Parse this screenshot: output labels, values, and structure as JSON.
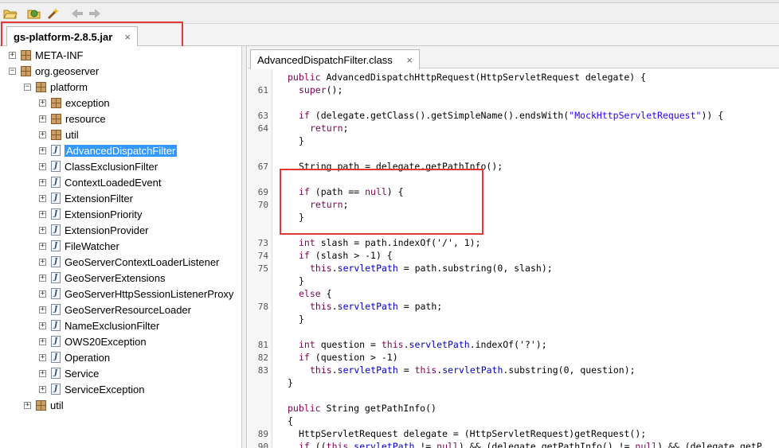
{
  "toolbar": {
    "icons": [
      "open-folder-icon",
      "open-type-icon",
      "wand-icon",
      "back-arrow-icon",
      "forward-arrow-icon"
    ]
  },
  "jar_tab": {
    "title": "gs-platform-2.8.5.jar",
    "close": "×"
  },
  "editor_tab": {
    "title": "AdvancedDispatchFilter.class",
    "close": "×"
  },
  "tree": {
    "items": [
      {
        "label": "META-INF",
        "type": "package",
        "indent": 0,
        "expander": "+"
      },
      {
        "label": "org.geoserver",
        "type": "package",
        "indent": 0,
        "expander": "−"
      },
      {
        "label": "platform",
        "type": "package",
        "indent": 1,
        "expander": "−"
      },
      {
        "label": "exception",
        "type": "package",
        "indent": 2,
        "expander": "+"
      },
      {
        "label": "resource",
        "type": "package",
        "indent": 2,
        "expander": "+"
      },
      {
        "label": "util",
        "type": "package",
        "indent": 2,
        "expander": "+"
      },
      {
        "label": "AdvancedDispatchFilter",
        "type": "class",
        "indent": 2,
        "expander": "+",
        "selected": true
      },
      {
        "label": "ClassExclusionFilter",
        "type": "class",
        "indent": 2,
        "expander": "+"
      },
      {
        "label": "ContextLoadedEvent",
        "type": "class",
        "indent": 2,
        "expander": "+"
      },
      {
        "label": "ExtensionFilter",
        "type": "class",
        "indent": 2,
        "expander": "+"
      },
      {
        "label": "ExtensionPriority",
        "type": "class",
        "indent": 2,
        "expander": "+"
      },
      {
        "label": "ExtensionProvider",
        "type": "class",
        "indent": 2,
        "expander": "+"
      },
      {
        "label": "FileWatcher",
        "type": "class",
        "indent": 2,
        "expander": "+"
      },
      {
        "label": "GeoServerContextLoaderListener",
        "type": "class",
        "indent": 2,
        "expander": "+"
      },
      {
        "label": "GeoServerExtensions",
        "type": "class",
        "indent": 2,
        "expander": "+"
      },
      {
        "label": "GeoServerHttpSessionListenerProxy",
        "type": "class",
        "indent": 2,
        "expander": "+"
      },
      {
        "label": "GeoServerResourceLoader",
        "type": "class",
        "indent": 2,
        "expander": "+"
      },
      {
        "label": "NameExclusionFilter",
        "type": "class",
        "indent": 2,
        "expander": "+"
      },
      {
        "label": "OWS20Exception",
        "type": "class",
        "indent": 2,
        "expander": "+"
      },
      {
        "label": "Operation",
        "type": "class",
        "indent": 2,
        "expander": "+"
      },
      {
        "label": "Service",
        "type": "class",
        "indent": 2,
        "expander": "+"
      },
      {
        "label": "ServiceException",
        "type": "class",
        "indent": 2,
        "expander": "+"
      },
      {
        "label": "util",
        "type": "package",
        "indent": 1,
        "expander": "+"
      }
    ]
  },
  "code": {
    "lines": [
      {
        "num": "",
        "indent": 1,
        "tokens": [
          [
            "kw",
            "public "
          ],
          [
            "",
            "AdvancedDispatchHttpRequest(HttpServletRequest delegate) {"
          ]
        ]
      },
      {
        "num": "61",
        "indent": 2,
        "tokens": [
          [
            "kw",
            "super"
          ],
          [
            "",
            "();"
          ]
        ]
      },
      {
        "num": "",
        "indent": 0,
        "tokens": []
      },
      {
        "num": "63",
        "indent": 2,
        "tokens": [
          [
            "kw",
            "if "
          ],
          [
            "",
            "(delegate.getClass().getSimpleName().endsWith("
          ],
          [
            "str",
            "\"MockHttpServletRequest\""
          ],
          [
            "",
            ")) {"
          ]
        ]
      },
      {
        "num": "64",
        "indent": 3,
        "tokens": [
          [
            "kw",
            "return"
          ],
          [
            "",
            ";"
          ]
        ]
      },
      {
        "num": "",
        "indent": 2,
        "tokens": [
          [
            "",
            "}"
          ]
        ]
      },
      {
        "num": "",
        "indent": 0,
        "tokens": []
      },
      {
        "num": "67",
        "indent": 2,
        "tokens": [
          [
            "",
            "String path = delegate.getPathInfo();"
          ]
        ]
      },
      {
        "num": "",
        "indent": 0,
        "tokens": []
      },
      {
        "num": "69",
        "indent": 2,
        "tokens": [
          [
            "kw",
            "if "
          ],
          [
            "",
            "(path == "
          ],
          [
            "kw",
            "null"
          ],
          [
            "",
            ") {"
          ]
        ]
      },
      {
        "num": "70",
        "indent": 3,
        "tokens": [
          [
            "kw",
            "return"
          ],
          [
            "",
            ";"
          ]
        ]
      },
      {
        "num": "",
        "indent": 2,
        "tokens": [
          [
            "",
            "}"
          ]
        ]
      },
      {
        "num": "",
        "indent": 0,
        "tokens": []
      },
      {
        "num": "73",
        "indent": 2,
        "tokens": [
          [
            "kw",
            "int "
          ],
          [
            "",
            "slash = path.indexOf('/', 1);"
          ]
        ]
      },
      {
        "num": "74",
        "indent": 2,
        "tokens": [
          [
            "kw",
            "if "
          ],
          [
            "",
            "(slash > -1) {"
          ]
        ]
      },
      {
        "num": "75",
        "indent": 3,
        "tokens": [
          [
            "kw",
            "this"
          ],
          [
            "",
            "."
          ],
          [
            "fld",
            "servletPath"
          ],
          [
            "",
            " = path.substring(0, slash);"
          ]
        ]
      },
      {
        "num": "",
        "indent": 2,
        "tokens": [
          [
            "",
            "}"
          ]
        ]
      },
      {
        "num": "",
        "indent": 2,
        "tokens": [
          [
            "kw",
            "else "
          ],
          [
            "",
            "{"
          ]
        ]
      },
      {
        "num": "78",
        "indent": 3,
        "tokens": [
          [
            "kw",
            "this"
          ],
          [
            "",
            "."
          ],
          [
            "fld",
            "servletPath"
          ],
          [
            "",
            " = path;"
          ]
        ]
      },
      {
        "num": "",
        "indent": 2,
        "tokens": [
          [
            "",
            "}"
          ]
        ]
      },
      {
        "num": "",
        "indent": 0,
        "tokens": []
      },
      {
        "num": "81",
        "indent": 2,
        "tokens": [
          [
            "kw",
            "int "
          ],
          [
            "",
            "question = "
          ],
          [
            "kw",
            "this"
          ],
          [
            "",
            "."
          ],
          [
            "fld",
            "servletPath"
          ],
          [
            "",
            ".indexOf('?');"
          ]
        ]
      },
      {
        "num": "82",
        "indent": 2,
        "tokens": [
          [
            "kw",
            "if "
          ],
          [
            "",
            "(question > -1)"
          ]
        ]
      },
      {
        "num": "83",
        "indent": 3,
        "tokens": [
          [
            "kw",
            "this"
          ],
          [
            "",
            "."
          ],
          [
            "fld",
            "servletPath"
          ],
          [
            "",
            " = "
          ],
          [
            "kw",
            "this"
          ],
          [
            "",
            "."
          ],
          [
            "fld",
            "servletPath"
          ],
          [
            "",
            ".substring(0, question);"
          ]
        ]
      },
      {
        "num": "",
        "indent": 1,
        "tokens": [
          [
            "",
            "}"
          ]
        ]
      },
      {
        "num": "",
        "indent": 0,
        "tokens": []
      },
      {
        "num": "",
        "indent": 1,
        "tokens": [
          [
            "kw",
            "public "
          ],
          [
            "",
            "String getPathInfo()"
          ]
        ]
      },
      {
        "num": "",
        "indent": 1,
        "tokens": [
          [
            "",
            "{"
          ]
        ]
      },
      {
        "num": "89",
        "indent": 2,
        "tokens": [
          [
            "",
            "HttpServletRequest delegate = (HttpServletRequest)getRequest();"
          ]
        ]
      },
      {
        "num": "90",
        "indent": 2,
        "tokens": [
          [
            "kw",
            "if "
          ],
          [
            "",
            "(("
          ],
          [
            "kw",
            "this"
          ],
          [
            "",
            "."
          ],
          [
            "fld",
            "servletPath"
          ],
          [
            "",
            " != "
          ],
          [
            "kw",
            "null"
          ],
          [
            "",
            ") && (delegate.getPathInfo() != "
          ],
          [
            "kw",
            "null"
          ],
          [
            "",
            ") && (delegate.getP"
          ]
        ]
      }
    ]
  }
}
